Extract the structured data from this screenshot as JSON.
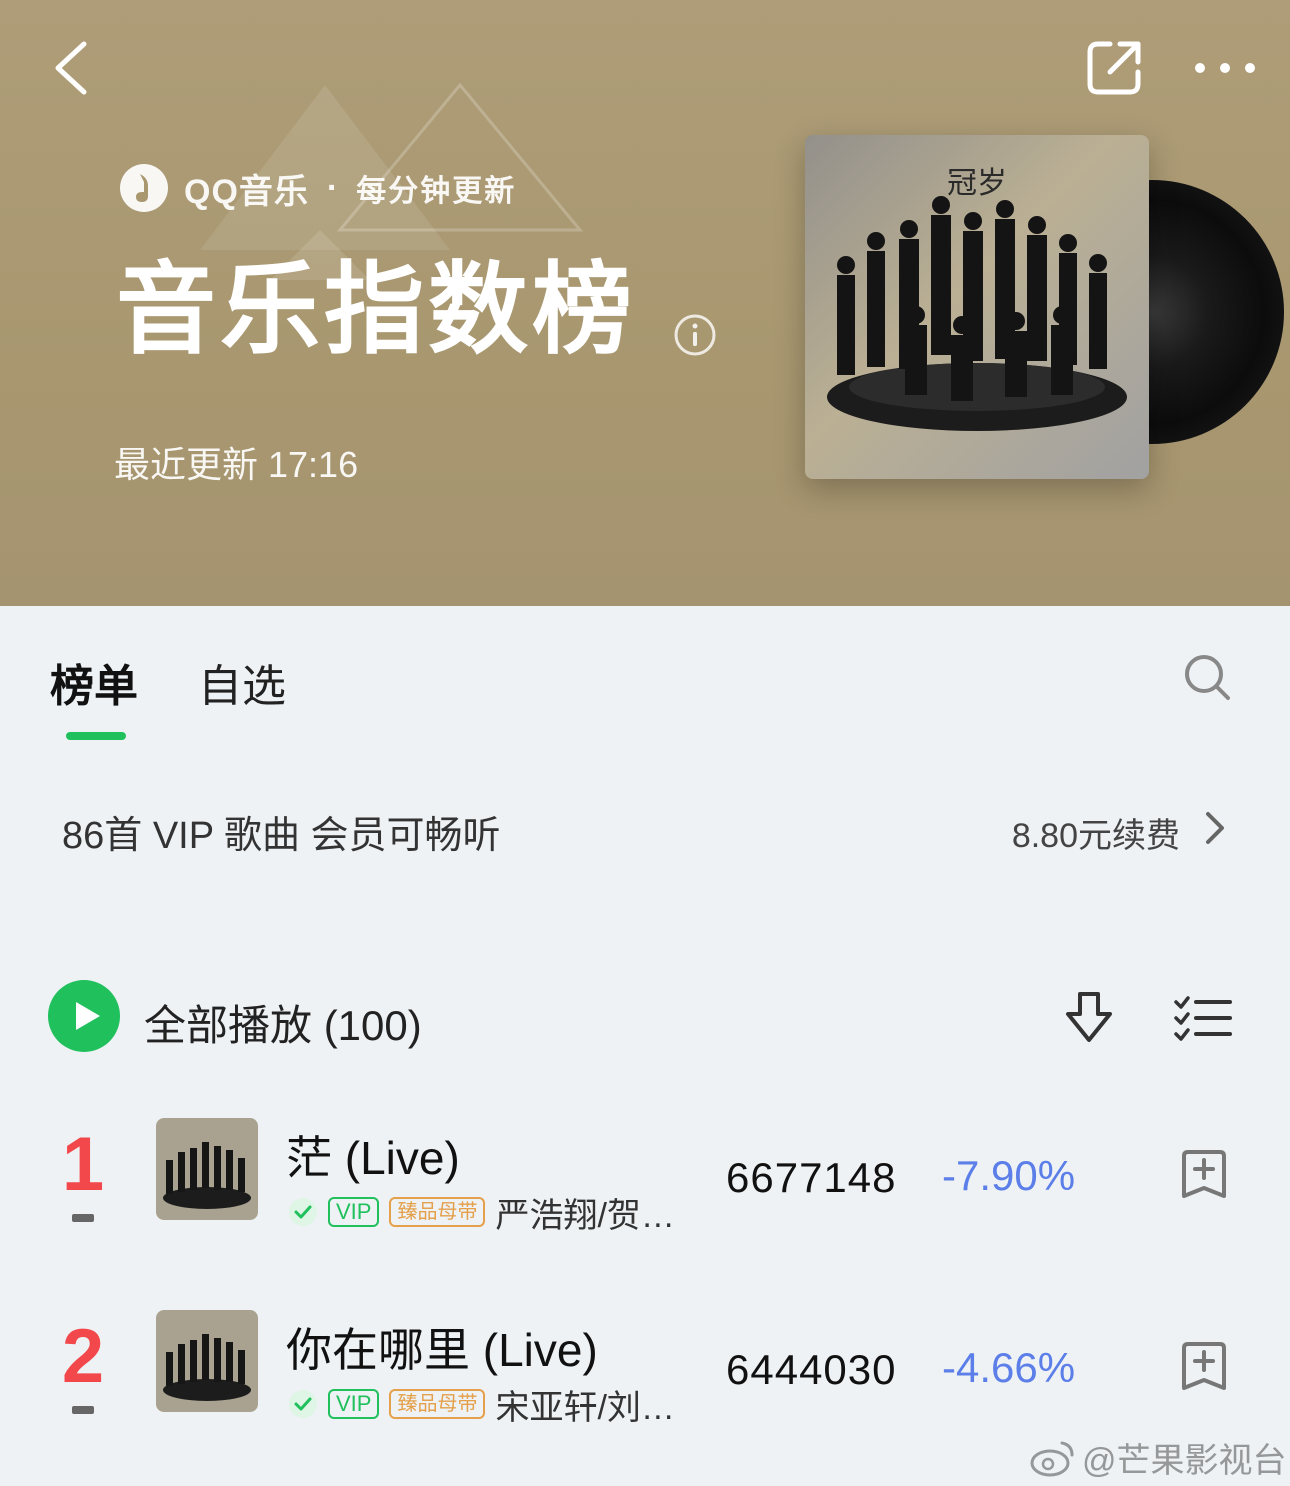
{
  "header": {
    "brand_name": "QQ音乐",
    "brand_separator": "·",
    "brand_tagline": "每分钟更新",
    "title": "音乐指数榜",
    "update_text": "最近更新 17:16",
    "album_cover_text": "冠岁"
  },
  "tabs": [
    {
      "label": "榜单",
      "active": true
    },
    {
      "label": "自选",
      "active": false
    }
  ],
  "vip": {
    "text": "86首 VIP 歌曲 会员可畅听",
    "price_text": "8.80元续费"
  },
  "play_all": {
    "label": "全部播放",
    "count": "(100)"
  },
  "songs": [
    {
      "rank": "1",
      "title": "茫 (Live)",
      "vip_badge": "VIP",
      "quality_badge": "臻品母带",
      "artist": "严浩翔/贺…",
      "plays": "6677148",
      "change": "-7.90%"
    },
    {
      "rank": "2",
      "title": "你在哪里 (Live)",
      "vip_badge": "VIP",
      "quality_badge": "臻品母带",
      "artist": "宋亚轩/刘…",
      "plays": "6444030",
      "change": "-4.66%"
    }
  ],
  "watermark": "@芒果影视台",
  "colors": {
    "accent_green": "#20c05c",
    "rank_red": "#f2484b",
    "change_blue": "#5b7ee8",
    "master_gold": "#e4a04a",
    "header_bg": "#a8976f"
  },
  "icons": {
    "back": "chevron-left-icon",
    "share": "share-icon",
    "more": "more-icon",
    "info": "info-icon",
    "search": "search-icon",
    "play": "play-icon",
    "download": "download-icon",
    "multiselect": "multiselect-icon",
    "add": "add-to-playlist-icon"
  }
}
